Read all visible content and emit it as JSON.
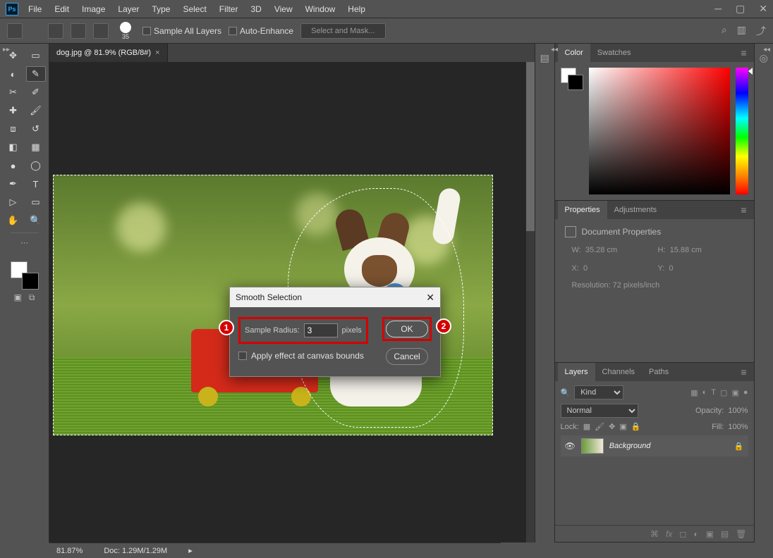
{
  "menu": {
    "items": [
      "File",
      "Edit",
      "Image",
      "Layer",
      "Type",
      "Select",
      "Filter",
      "3D",
      "View",
      "Window",
      "Help"
    ]
  },
  "options": {
    "brush_size": "35",
    "sample_all_layers": "Sample All Layers",
    "auto_enhance": "Auto-Enhance",
    "select_and_mask": "Select and Mask..."
  },
  "tab": {
    "label": "dog.jpg @ 81.9% (RGB/8#)"
  },
  "dialog": {
    "title": "Smooth Selection",
    "radius_label": "Sample Radius:",
    "radius_value": "3",
    "radius_unit": "pixels",
    "apply_bounds": "Apply effect at canvas bounds",
    "ok": "OK",
    "cancel": "Cancel",
    "badge1": "1",
    "badge2": "2"
  },
  "panels": {
    "color": {
      "tabs": [
        "Color",
        "Swatches"
      ]
    },
    "properties": {
      "tabs": [
        "Properties",
        "Adjustments"
      ],
      "title": "Document Properties",
      "w_label": "W:",
      "w_val": "35.28 cm",
      "h_label": "H:",
      "h_val": "15.88 cm",
      "x_label": "X:",
      "x_val": "0",
      "y_label": "Y:",
      "y_val": "0",
      "res": "Resolution: 72 pixels/inch"
    },
    "layers": {
      "tabs": [
        "Layers",
        "Channels",
        "Paths"
      ],
      "kind": "Kind",
      "blend": "Normal",
      "opacity_label": "Opacity:",
      "opacity_val": "100%",
      "lock_label": "Lock:",
      "fill_label": "Fill:",
      "fill_val": "100%",
      "bg": "Background"
    }
  },
  "status": {
    "zoom": "81.87%",
    "doc": "Doc: 1.29M/1.29M"
  },
  "search_placeholder": "Kind"
}
